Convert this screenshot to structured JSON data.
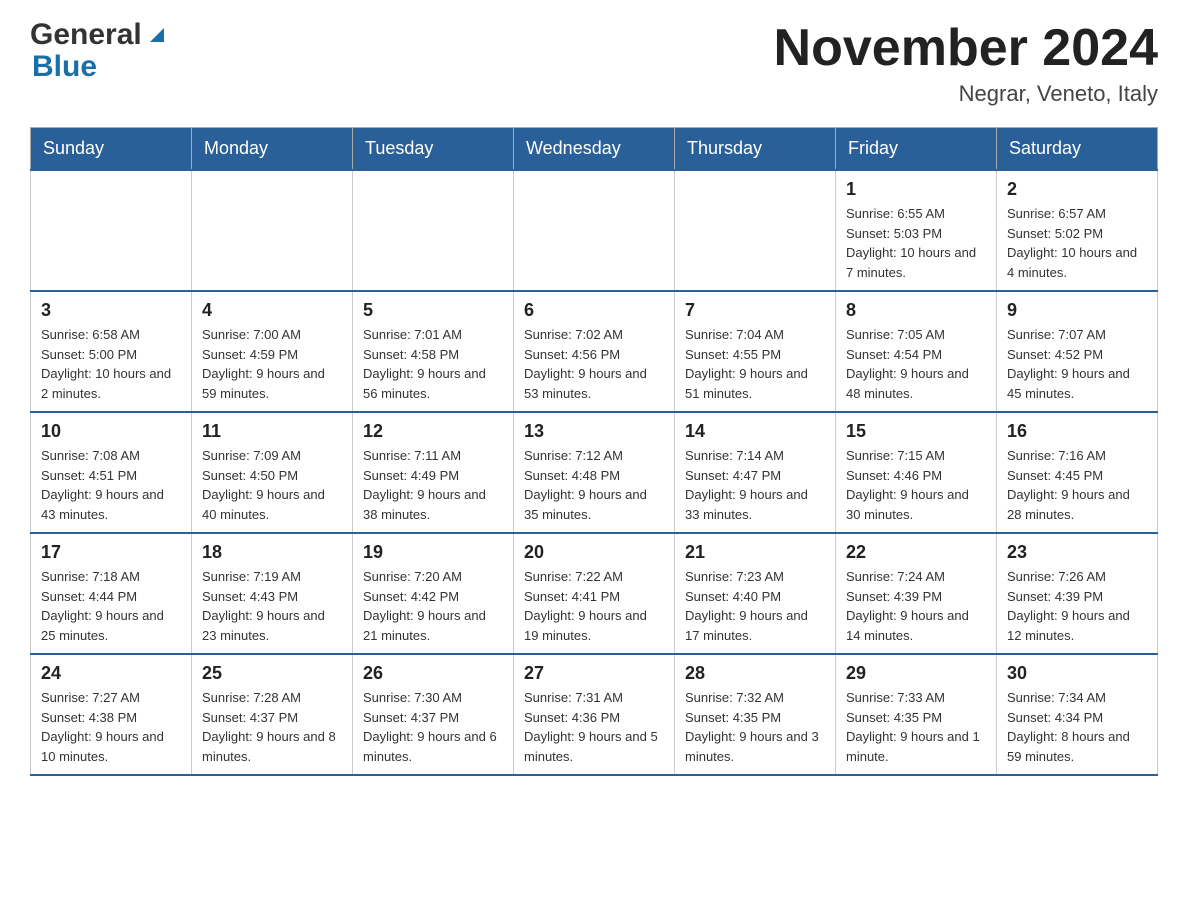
{
  "header": {
    "logo_general": "General",
    "logo_blue": "Blue",
    "month_title": "November 2024",
    "location": "Negrar, Veneto, Italy"
  },
  "weekdays": [
    "Sunday",
    "Monday",
    "Tuesday",
    "Wednesday",
    "Thursday",
    "Friday",
    "Saturday"
  ],
  "weeks": [
    [
      {
        "day": "",
        "info": ""
      },
      {
        "day": "",
        "info": ""
      },
      {
        "day": "",
        "info": ""
      },
      {
        "day": "",
        "info": ""
      },
      {
        "day": "",
        "info": ""
      },
      {
        "day": "1",
        "info": "Sunrise: 6:55 AM\nSunset: 5:03 PM\nDaylight: 10 hours and 7 minutes."
      },
      {
        "day": "2",
        "info": "Sunrise: 6:57 AM\nSunset: 5:02 PM\nDaylight: 10 hours and 4 minutes."
      }
    ],
    [
      {
        "day": "3",
        "info": "Sunrise: 6:58 AM\nSunset: 5:00 PM\nDaylight: 10 hours and 2 minutes."
      },
      {
        "day": "4",
        "info": "Sunrise: 7:00 AM\nSunset: 4:59 PM\nDaylight: 9 hours and 59 minutes."
      },
      {
        "day": "5",
        "info": "Sunrise: 7:01 AM\nSunset: 4:58 PM\nDaylight: 9 hours and 56 minutes."
      },
      {
        "day": "6",
        "info": "Sunrise: 7:02 AM\nSunset: 4:56 PM\nDaylight: 9 hours and 53 minutes."
      },
      {
        "day": "7",
        "info": "Sunrise: 7:04 AM\nSunset: 4:55 PM\nDaylight: 9 hours and 51 minutes."
      },
      {
        "day": "8",
        "info": "Sunrise: 7:05 AM\nSunset: 4:54 PM\nDaylight: 9 hours and 48 minutes."
      },
      {
        "day": "9",
        "info": "Sunrise: 7:07 AM\nSunset: 4:52 PM\nDaylight: 9 hours and 45 minutes."
      }
    ],
    [
      {
        "day": "10",
        "info": "Sunrise: 7:08 AM\nSunset: 4:51 PM\nDaylight: 9 hours and 43 minutes."
      },
      {
        "day": "11",
        "info": "Sunrise: 7:09 AM\nSunset: 4:50 PM\nDaylight: 9 hours and 40 minutes."
      },
      {
        "day": "12",
        "info": "Sunrise: 7:11 AM\nSunset: 4:49 PM\nDaylight: 9 hours and 38 minutes."
      },
      {
        "day": "13",
        "info": "Sunrise: 7:12 AM\nSunset: 4:48 PM\nDaylight: 9 hours and 35 minutes."
      },
      {
        "day": "14",
        "info": "Sunrise: 7:14 AM\nSunset: 4:47 PM\nDaylight: 9 hours and 33 minutes."
      },
      {
        "day": "15",
        "info": "Sunrise: 7:15 AM\nSunset: 4:46 PM\nDaylight: 9 hours and 30 minutes."
      },
      {
        "day": "16",
        "info": "Sunrise: 7:16 AM\nSunset: 4:45 PM\nDaylight: 9 hours and 28 minutes."
      }
    ],
    [
      {
        "day": "17",
        "info": "Sunrise: 7:18 AM\nSunset: 4:44 PM\nDaylight: 9 hours and 25 minutes."
      },
      {
        "day": "18",
        "info": "Sunrise: 7:19 AM\nSunset: 4:43 PM\nDaylight: 9 hours and 23 minutes."
      },
      {
        "day": "19",
        "info": "Sunrise: 7:20 AM\nSunset: 4:42 PM\nDaylight: 9 hours and 21 minutes."
      },
      {
        "day": "20",
        "info": "Sunrise: 7:22 AM\nSunset: 4:41 PM\nDaylight: 9 hours and 19 minutes."
      },
      {
        "day": "21",
        "info": "Sunrise: 7:23 AM\nSunset: 4:40 PM\nDaylight: 9 hours and 17 minutes."
      },
      {
        "day": "22",
        "info": "Sunrise: 7:24 AM\nSunset: 4:39 PM\nDaylight: 9 hours and 14 minutes."
      },
      {
        "day": "23",
        "info": "Sunrise: 7:26 AM\nSunset: 4:39 PM\nDaylight: 9 hours and 12 minutes."
      }
    ],
    [
      {
        "day": "24",
        "info": "Sunrise: 7:27 AM\nSunset: 4:38 PM\nDaylight: 9 hours and 10 minutes."
      },
      {
        "day": "25",
        "info": "Sunrise: 7:28 AM\nSunset: 4:37 PM\nDaylight: 9 hours and 8 minutes."
      },
      {
        "day": "26",
        "info": "Sunrise: 7:30 AM\nSunset: 4:37 PM\nDaylight: 9 hours and 6 minutes."
      },
      {
        "day": "27",
        "info": "Sunrise: 7:31 AM\nSunset: 4:36 PM\nDaylight: 9 hours and 5 minutes."
      },
      {
        "day": "28",
        "info": "Sunrise: 7:32 AM\nSunset: 4:35 PM\nDaylight: 9 hours and 3 minutes."
      },
      {
        "day": "29",
        "info": "Sunrise: 7:33 AM\nSunset: 4:35 PM\nDaylight: 9 hours and 1 minute."
      },
      {
        "day": "30",
        "info": "Sunrise: 7:34 AM\nSunset: 4:34 PM\nDaylight: 8 hours and 59 minutes."
      }
    ]
  ]
}
